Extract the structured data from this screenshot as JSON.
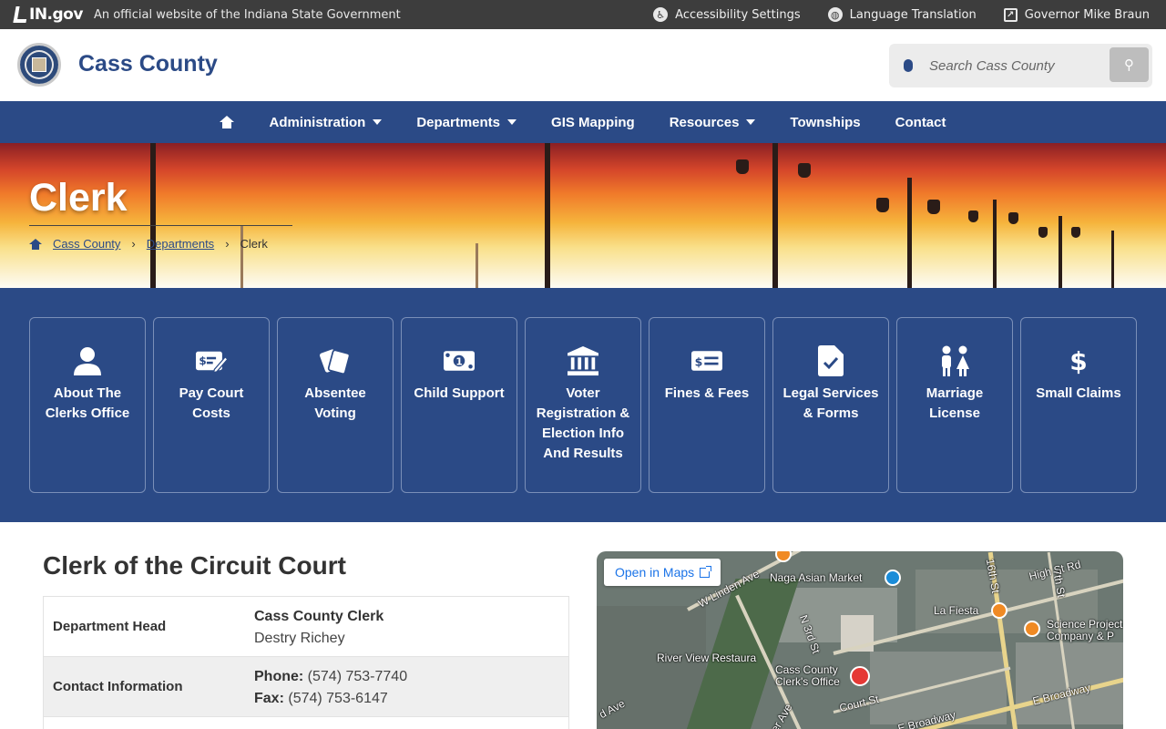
{
  "topbar": {
    "ingov_logo": "IN.gov",
    "official_text": "An official website of the Indiana State Government",
    "links": [
      {
        "label": "Accessibility Settings",
        "icon": "accessibility-icon"
      },
      {
        "label": "Language Translation",
        "icon": "globe-icon"
      },
      {
        "label": "Governor Mike Braun",
        "icon": "external-link-icon"
      }
    ]
  },
  "header": {
    "site_title": "Cass County",
    "search_placeholder": "Search Cass County"
  },
  "nav": {
    "items": [
      {
        "label": "Administration",
        "dropdown": true
      },
      {
        "label": "Departments",
        "dropdown": true
      },
      {
        "label": "GIS Mapping",
        "dropdown": false
      },
      {
        "label": "Resources",
        "dropdown": true
      },
      {
        "label": "Townships",
        "dropdown": false
      },
      {
        "label": "Contact",
        "dropdown": false
      }
    ]
  },
  "hero": {
    "title": "Clerk",
    "breadcrumb": [
      "Cass County",
      "Departments",
      "Clerk"
    ]
  },
  "tiles": [
    {
      "label": "About The Clerks Office",
      "icon": "user-icon"
    },
    {
      "label": "Pay Court Costs",
      "icon": "money-check-pen-icon"
    },
    {
      "label": "Absentee Voting",
      "icon": "ballot-cards-icon"
    },
    {
      "label": "Child Support",
      "icon": "money-bill-icon"
    },
    {
      "label": "Voter Registration & Election Info And Results",
      "icon": "landmark-icon"
    },
    {
      "label": "Fines & Fees",
      "icon": "money-check-dollar-icon"
    },
    {
      "label": "Legal Services & Forms",
      "icon": "file-check-icon"
    },
    {
      "label": "Marriage License",
      "icon": "couple-icon"
    },
    {
      "label": "Small Claims",
      "icon": "dollar-sign-icon"
    }
  ],
  "main": {
    "heading": "Clerk of the Circuit Court",
    "info": [
      {
        "key": "Department Head",
        "lines": [
          "Cass County Clerk",
          "Destry Richey"
        ]
      },
      {
        "key": "Contact Information",
        "phone_label": "Phone:",
        "phone": "(574) 753-7740",
        "fax_label": "Fax:",
        "fax": "(574) 753-6147"
      }
    ]
  },
  "map": {
    "open_label": "Open in Maps",
    "labels": [
      "Naga Asian Market",
      "High St Rd",
      "16th St",
      "7th St",
      "W Linden Ave",
      "N 3rd St",
      "La Fiesta",
      "Science Project Company & P",
      "River View Restaura",
      "Cass County Clerk's Office",
      "Court St",
      "E Broadway",
      "E Broadway",
      "d Ave",
      "er Ave"
    ]
  }
}
